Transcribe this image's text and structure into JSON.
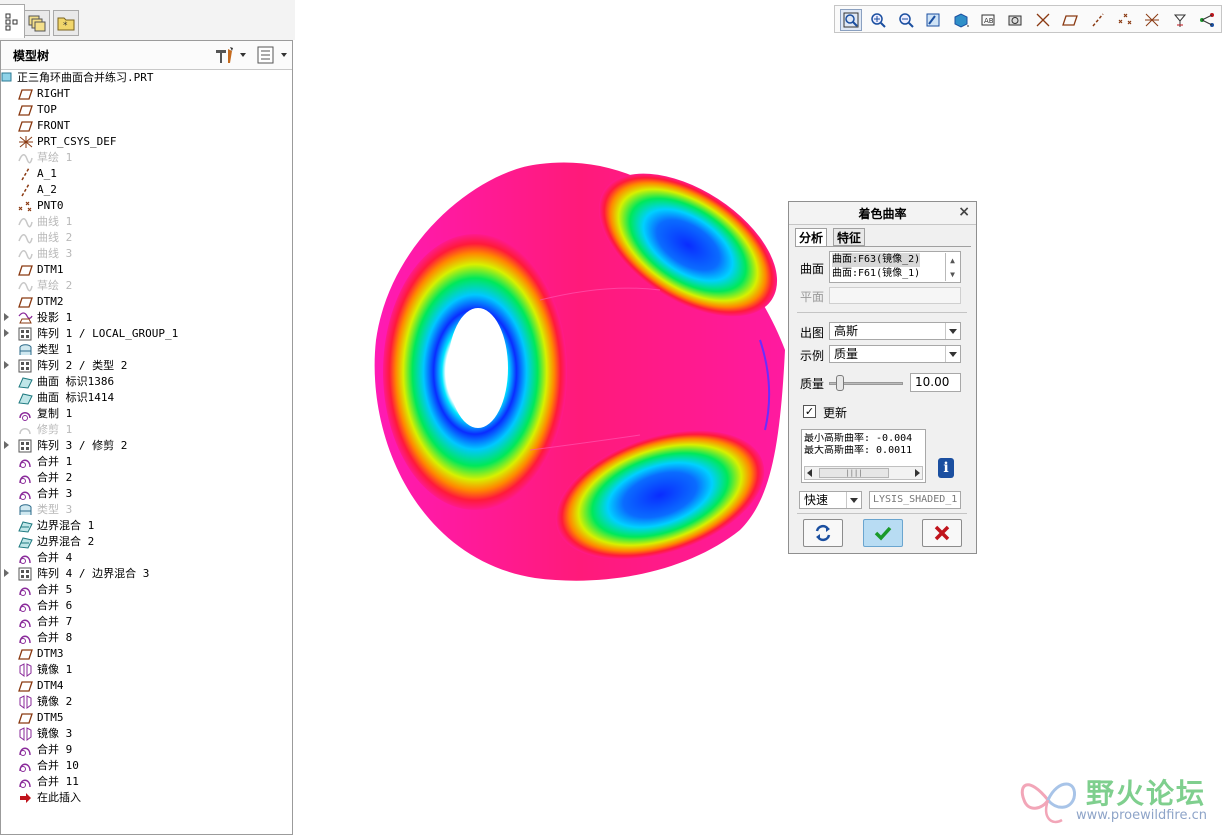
{
  "left_tabs": [
    {
      "name": "model-tree-tab",
      "icon": "model-tree-icon"
    },
    {
      "name": "layers-tab",
      "icon": "layers-icon"
    },
    {
      "name": "favorites-tab",
      "icon": "folder-star-icon"
    }
  ],
  "model_tree": {
    "title": "模型树",
    "settings_icon": "tools-icon",
    "show_icon": "list-icon",
    "root": "正三角环曲面合并练习.PRT",
    "items": [
      {
        "label": "RIGHT",
        "icon": "datum-plane-icon",
        "dim": false,
        "expandable": false
      },
      {
        "label": "TOP",
        "icon": "datum-plane-icon",
        "dim": false,
        "expandable": false
      },
      {
        "label": "FRONT",
        "icon": "datum-plane-icon",
        "dim": false,
        "expandable": false
      },
      {
        "label": "PRT_CSYS_DEF",
        "icon": "coordinate-system-icon",
        "dim": false,
        "expandable": false
      },
      {
        "label": "草绘 1",
        "icon": "sketch-icon",
        "dim": true,
        "expandable": false
      },
      {
        "label": "A_1",
        "icon": "datum-axis-icon",
        "dim": false,
        "expandable": false
      },
      {
        "label": "A_2",
        "icon": "datum-axis-icon",
        "dim": false,
        "expandable": false
      },
      {
        "label": "PNT0",
        "icon": "datum-point-icon",
        "dim": false,
        "expandable": false
      },
      {
        "label": "曲线 1",
        "icon": "curve-icon",
        "dim": true,
        "expandable": false
      },
      {
        "label": "曲线 2",
        "icon": "curve-icon",
        "dim": true,
        "expandable": false
      },
      {
        "label": "曲线 3",
        "icon": "curve-icon",
        "dim": true,
        "expandable": false
      },
      {
        "label": "DTM1",
        "icon": "datum-plane-icon",
        "dim": false,
        "expandable": false
      },
      {
        "label": "草绘 2",
        "icon": "sketch-icon",
        "dim": true,
        "expandable": false
      },
      {
        "label": "DTM2",
        "icon": "datum-plane-icon",
        "dim": false,
        "expandable": false
      },
      {
        "label": "投影 1",
        "icon": "projection-icon",
        "dim": false,
        "expandable": true
      },
      {
        "label": "阵列 1 / LOCAL_GROUP_1",
        "icon": "pattern-icon",
        "dim": false,
        "expandable": true
      },
      {
        "label": "类型 1",
        "icon": "style-surface-icon",
        "dim": false,
        "expandable": false
      },
      {
        "label": "阵列 2 / 类型 2",
        "icon": "pattern-icon",
        "dim": false,
        "expandable": true
      },
      {
        "label": "曲面 标识1386",
        "icon": "surface-icon",
        "dim": false,
        "expandable": false
      },
      {
        "label": "曲面 标识1414",
        "icon": "surface-icon",
        "dim": false,
        "expandable": false
      },
      {
        "label": "复制 1",
        "icon": "copy-surface-icon",
        "dim": false,
        "expandable": false
      },
      {
        "label": "修剪 1",
        "icon": "trim-icon",
        "dim": true,
        "expandable": false
      },
      {
        "label": "阵列 3 / 修剪 2",
        "icon": "pattern-icon",
        "dim": false,
        "expandable": true
      },
      {
        "label": "合并 1",
        "icon": "merge-icon",
        "dim": false,
        "expandable": false
      },
      {
        "label": "合并 2",
        "icon": "merge-icon",
        "dim": false,
        "expandable": false
      },
      {
        "label": "合并 3",
        "icon": "merge-icon",
        "dim": false,
        "expandable": false
      },
      {
        "label": "类型 3",
        "icon": "style-surface-icon",
        "dim": true,
        "expandable": false
      },
      {
        "label": "边界混合 1",
        "icon": "boundary-blend-icon",
        "dim": false,
        "expandable": false
      },
      {
        "label": "边界混合 2",
        "icon": "boundary-blend-icon",
        "dim": false,
        "expandable": false
      },
      {
        "label": "合并 4",
        "icon": "merge-icon",
        "dim": false,
        "expandable": false
      },
      {
        "label": "阵列 4 / 边界混合 3",
        "icon": "pattern-icon",
        "dim": false,
        "expandable": true
      },
      {
        "label": "合并 5",
        "icon": "merge-icon",
        "dim": false,
        "expandable": false
      },
      {
        "label": "合并 6",
        "icon": "merge-icon",
        "dim": false,
        "expandable": false
      },
      {
        "label": "合并 7",
        "icon": "merge-icon",
        "dim": false,
        "expandable": false
      },
      {
        "label": "合并 8",
        "icon": "merge-icon",
        "dim": false,
        "expandable": false
      },
      {
        "label": "DTM3",
        "icon": "datum-plane-icon",
        "dim": false,
        "expandable": false
      },
      {
        "label": "镜像 1",
        "icon": "mirror-icon",
        "dim": false,
        "expandable": false
      },
      {
        "label": "DTM4",
        "icon": "datum-plane-icon",
        "dim": false,
        "expandable": false
      },
      {
        "label": "镜像 2",
        "icon": "mirror-icon",
        "dim": false,
        "expandable": false
      },
      {
        "label": "DTM5",
        "icon": "datum-plane-icon",
        "dim": false,
        "expandable": false
      },
      {
        "label": "镜像 3",
        "icon": "mirror-icon",
        "dim": false,
        "expandable": false
      },
      {
        "label": "合并 9",
        "icon": "merge-icon",
        "dim": false,
        "expandable": false
      },
      {
        "label": "合并 10",
        "icon": "merge-icon",
        "dim": false,
        "expandable": false
      },
      {
        "label": "合并 11",
        "icon": "merge-icon",
        "dim": false,
        "expandable": false
      },
      {
        "label": "在此插入",
        "icon": "insert-here-arrow-icon",
        "dim": false,
        "expandable": false
      }
    ]
  },
  "toolbar": {
    "buttons": [
      "refit-icon",
      "zoom-in-icon",
      "zoom-out-icon",
      "repaint-icon",
      "view-style-icon",
      "saved-views-icon",
      "spin-center-icon",
      "csys-display-icon",
      "plane-display-icon",
      "axis-display-icon",
      "point-display-icon",
      "annotation-display-icon",
      "point-tag-icon",
      "graph-icon"
    ]
  },
  "dialog": {
    "title": "着色曲率",
    "tab_analysis": "分析",
    "tab_feature": "特征",
    "surface_label": "曲面",
    "surfaces": [
      "曲面:F63(镜像_2)",
      "曲面:F61(镜像_1)"
    ],
    "plane_label": "平面",
    "plane_value": "",
    "output_label": "出图",
    "output_value": "高斯",
    "sample_label": "示例",
    "sample_value": "质量",
    "quality_label": "质量",
    "quality_value": "10.00",
    "update_label": "更新",
    "update_checked": "✓",
    "result_line1": "最小高斯曲率: -0.004",
    "result_line2": "最大高斯曲率: 0.0011",
    "mode_value": "快速",
    "analysis_name": "LYSIS_SHADED_1",
    "scroll_thumb": "||||"
  },
  "watermark": {
    "cn": "野火论坛",
    "url": "www.proewildfire.cn"
  },
  "colors": {
    "magenta": "#ff1a8c",
    "toolbar_blue": "#1b4fa0",
    "ok_green": "#1a9a2a",
    "cancel_red": "#c0141c"
  }
}
